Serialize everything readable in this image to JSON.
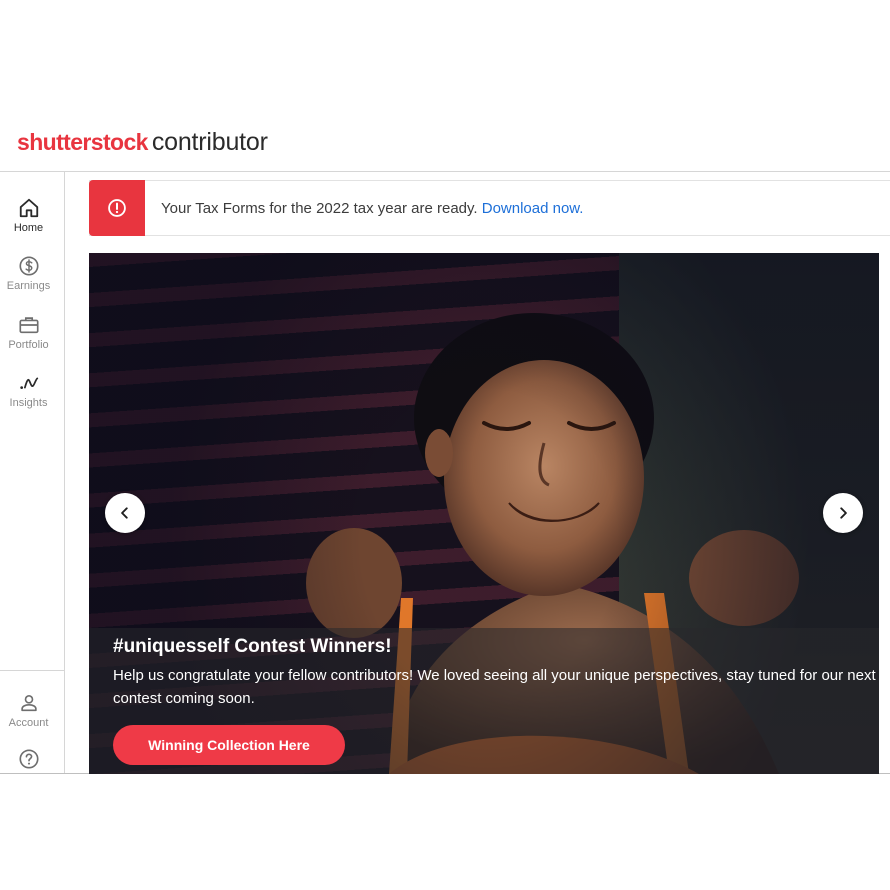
{
  "app": {
    "brand": "shutterstock",
    "product": "contributor",
    "brand_color": "#e8353f"
  },
  "sidebar": {
    "items": [
      {
        "label": "Home",
        "icon": "home-icon",
        "active": true
      },
      {
        "label": "Earnings",
        "icon": "dollar-circle-icon",
        "active": false
      },
      {
        "label": "Portfolio",
        "icon": "briefcase-icon",
        "active": false
      },
      {
        "label": "Insights",
        "icon": "insights-wave-icon",
        "active": false
      }
    ],
    "bottom_items": [
      {
        "label": "Account",
        "icon": "person-icon"
      },
      {
        "label": "",
        "icon": "help-circle-icon"
      }
    ]
  },
  "alert": {
    "icon": "alert-exclamation-icon",
    "message": "Your Tax Forms for the 2022 tax year are ready.",
    "link_label": "Download now."
  },
  "hero": {
    "title": "#uniquesself Contest Winners!",
    "body": "Help us congratulate your fellow contributors! We loved seeing all your unique perspectives, stay tuned for our next contest coming soon.",
    "cta_label": "Winning Collection Here",
    "prev_icon": "chevron-left-icon",
    "next_icon": "chevron-right-icon",
    "image_description": "photo-of-smiling-woman"
  }
}
